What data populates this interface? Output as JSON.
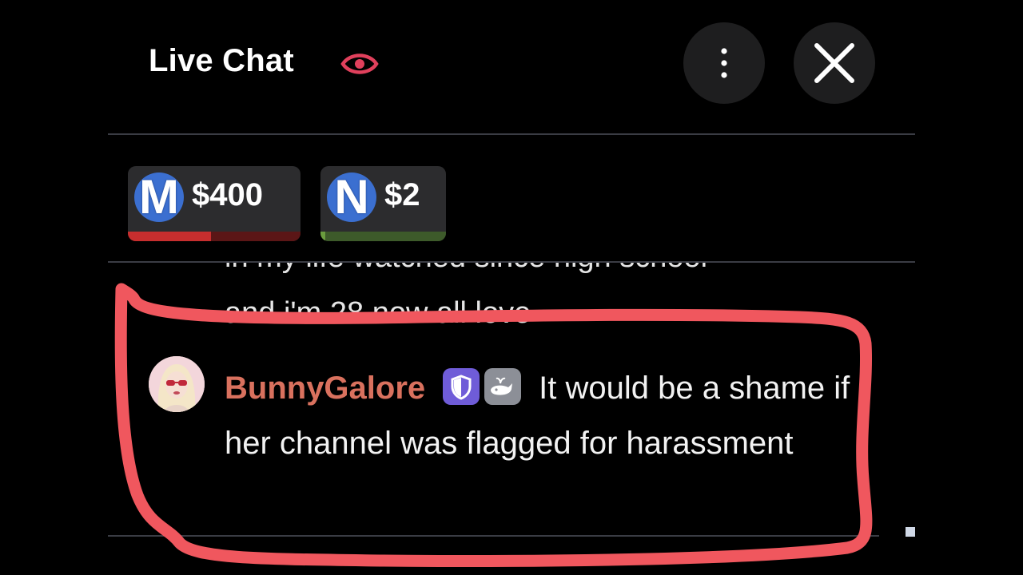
{
  "header": {
    "title": "Live Chat",
    "icons": {
      "visibility": "eye-icon",
      "menu": "more-vertical-icon",
      "close": "close-icon"
    }
  },
  "tips": [
    {
      "letter": "M",
      "amount": "$400",
      "bar_color": "#c72e2e",
      "progress": 0.48
    },
    {
      "letter": "N",
      "amount": "$2",
      "bar_color": "#6a9c3e",
      "progress": 0.04
    }
  ],
  "chat": {
    "previous_message_lines": [
      "in my life watched since high school",
      "and i'm 28 now all love"
    ],
    "highlighted_message": {
      "username": "BunnyGalore",
      "badges": [
        "moderator-shield-icon",
        "whale-icon"
      ],
      "text": "It would be a shame if her channel was flagged for harassment"
    }
  },
  "colors": {
    "background": "#000000",
    "accent_eye": "#e0405c",
    "username": "#d9715e",
    "highlight_outline": "#f0575e"
  }
}
